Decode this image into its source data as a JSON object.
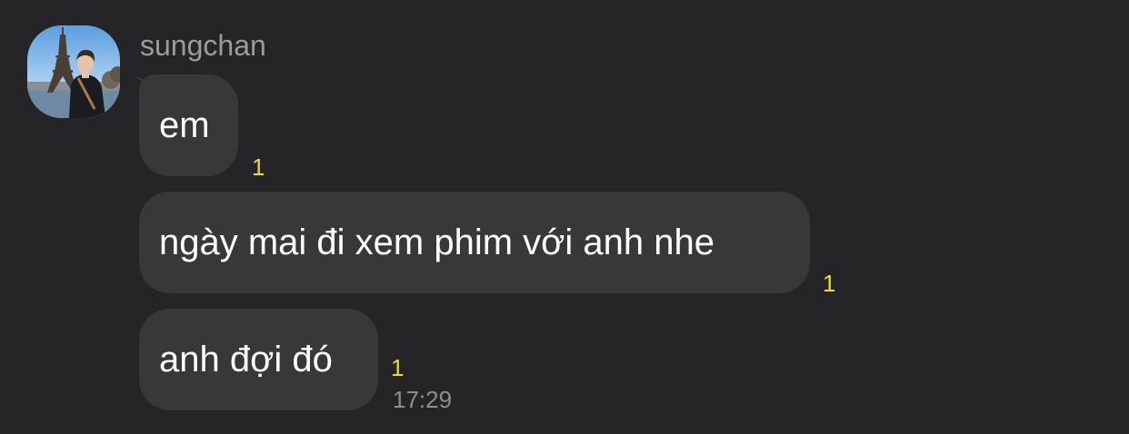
{
  "conversation": {
    "sender_name": "sungchan",
    "avatar_icon": "profile-photo-eiffel-tower",
    "messages": [
      {
        "text": "em",
        "unread_count": "1"
      },
      {
        "text": "ngày mai đi xem phim với anh nhe",
        "unread_count": "1"
      },
      {
        "text": "anh đợi đó",
        "unread_count": "1"
      }
    ],
    "timestamp": "17:29"
  },
  "colors": {
    "background": "#252527",
    "bubble": "#38383a",
    "message_text": "#ffffff",
    "sender_text": "#9b9b9e",
    "unread": "#f2dc1c",
    "timestamp": "#8e8e92"
  }
}
